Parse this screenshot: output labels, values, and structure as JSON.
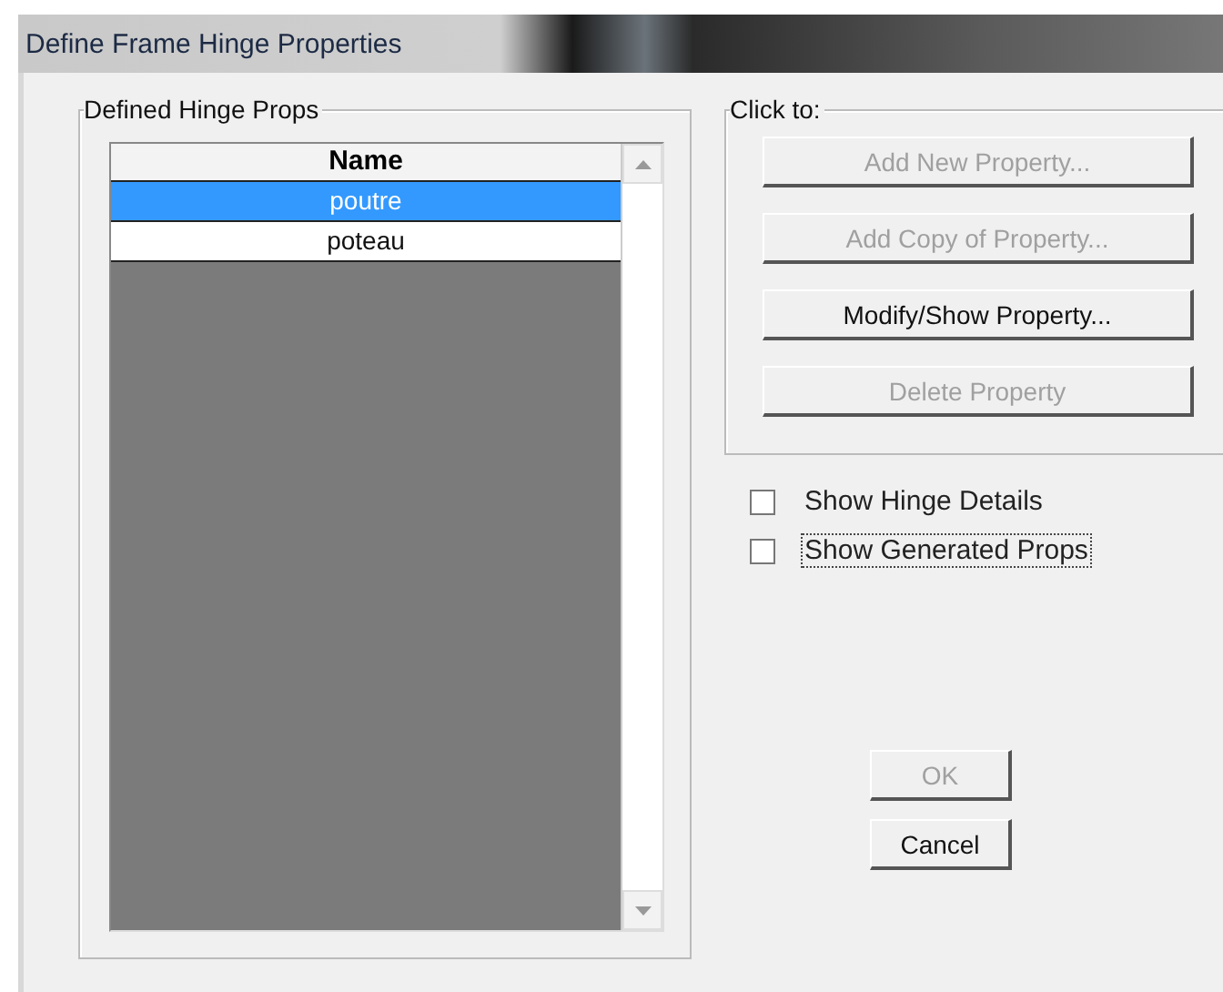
{
  "window": {
    "title": "Define Frame Hinge Properties"
  },
  "defined_hinge_props": {
    "title": "Defined Hinge Props",
    "column": "Name",
    "rows": [
      {
        "name": "poutre",
        "selected": true
      },
      {
        "name": "poteau",
        "selected": false
      }
    ]
  },
  "click_to": {
    "title": "Click to:",
    "buttons": [
      {
        "label": "Add New Property...",
        "disabled": true
      },
      {
        "label": "Add Copy of Property...",
        "disabled": true
      },
      {
        "label": "Modify/Show Property...",
        "disabled": false
      },
      {
        "label": "Delete Property",
        "disabled": true
      }
    ]
  },
  "options": [
    {
      "label": "Show Hinge Details",
      "checked": false,
      "focused": false
    },
    {
      "label": "Show Generated Props",
      "checked": false,
      "focused": true
    }
  ],
  "buttons": [
    {
      "label": "OK",
      "disabled": true
    },
    {
      "label": "Cancel",
      "disabled": false
    }
  ]
}
